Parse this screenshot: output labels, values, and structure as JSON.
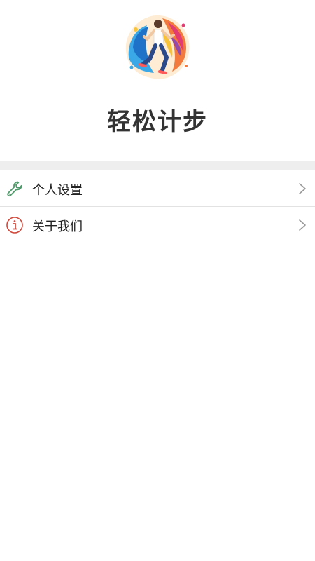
{
  "app": {
    "title": "轻松计步",
    "logo_icon": "running-person-logo"
  },
  "menu": {
    "items": [
      {
        "label": "个人设置",
        "icon": "wrench-icon",
        "icon_color": "#4f9a6a"
      },
      {
        "label": "关于我们",
        "icon": "info-icon",
        "icon_color": "#d0483b"
      }
    ]
  },
  "colors": {
    "background": "#ffffff",
    "section_divider": "#eeeeee",
    "text": "#333333",
    "chevron": "#999999"
  }
}
